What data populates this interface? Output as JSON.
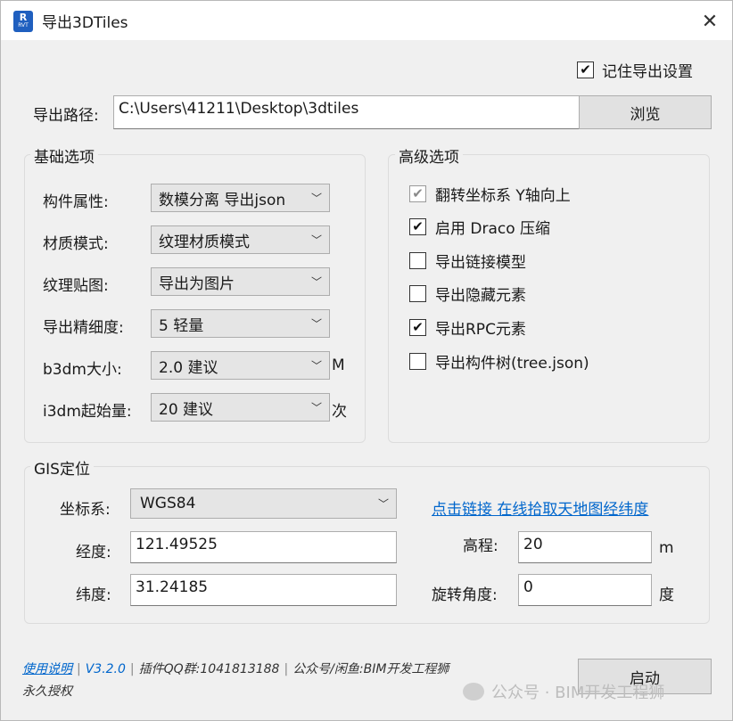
{
  "window": {
    "title": "导出3DTiles",
    "icon_line1": "R",
    "icon_line2": "RVT"
  },
  "remember_settings": {
    "label": "记住导出设置",
    "checked": true
  },
  "export_path": {
    "label": "导出路径:",
    "value": "C:\\Users\\41211\\Desktop\\3dtiles",
    "browse_label": "浏览"
  },
  "basic": {
    "title": "基础选项",
    "rows": [
      {
        "label": "构件属性:",
        "value": "数模分离 导出json",
        "unit": ""
      },
      {
        "label": "材质模式:",
        "value": "纹理材质模式",
        "unit": ""
      },
      {
        "label": "纹理贴图:",
        "value": "导出为图片",
        "unit": ""
      },
      {
        "label": "导出精细度:",
        "value": "5 轻量",
        "unit": ""
      },
      {
        "label": "b3dm大小:",
        "value": "2.0 建议",
        "unit": "M"
      },
      {
        "label": "i3dm起始量:",
        "value": "20 建议",
        "unit": "次"
      }
    ]
  },
  "advanced": {
    "title": "高级选项",
    "options": [
      {
        "label": "翻转坐标系 Y轴向上",
        "checked": true,
        "disabled": true
      },
      {
        "label": "启用 Draco 压缩",
        "checked": true,
        "disabled": false
      },
      {
        "label": "导出链接模型",
        "checked": false,
        "disabled": false
      },
      {
        "label": "导出隐藏元素",
        "checked": false,
        "disabled": false
      },
      {
        "label": "导出RPC元素",
        "checked": true,
        "disabled": false
      },
      {
        "label": "导出构件树(tree.json)",
        "checked": false,
        "disabled": false
      }
    ]
  },
  "gis": {
    "title": "GIS定位",
    "crs_label": "坐标系:",
    "crs_value": "WGS84",
    "link_text": "点击链接 在线拾取天地图经纬度",
    "longitude_label": "经度:",
    "longitude_value": "121.49525",
    "latitude_label": "纬度:",
    "latitude_value": "31.24185",
    "elevation_label": "高程:",
    "elevation_value": "20",
    "elevation_unit": "m",
    "rotation_label": "旋转角度:",
    "rotation_value": "0",
    "rotation_unit": "度"
  },
  "footer": {
    "manual_link": "使用说明",
    "version": "V3.2.0",
    "qq_group": "插件QQ群:1041813188",
    "wechat": "公众号/闲鱼:BIM开发工程狮",
    "license": "永久授权",
    "start_label": "启动"
  },
  "watermark": {
    "text": "公众号 · BIM开发工程狮"
  },
  "colors": {
    "accent_link": "#0066cc",
    "icon_blue": "#1f5fbf"
  }
}
